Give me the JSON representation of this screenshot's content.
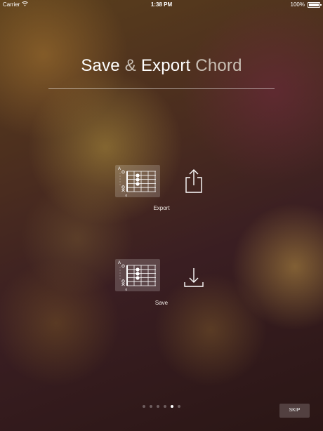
{
  "status_bar": {
    "carrier": "Carrier",
    "time": "1:38 PM",
    "battery_percent": "100%",
    "icons": [
      "wifi-icon",
      "battery-icon"
    ]
  },
  "title": {
    "word1": "Save",
    "amp": "&",
    "word2": "Export",
    "word3": "Chord"
  },
  "features": [
    {
      "label": "Export",
      "icon": "share-icon",
      "chord_card": "chord-diagram-icon"
    },
    {
      "label": "Save",
      "icon": "download-icon",
      "chord_card": "chord-diagram-icon"
    }
  ],
  "chord_diagram": {
    "chord_name": "A",
    "fret": "0"
  },
  "pagination": {
    "total": 6,
    "active_index": 4
  },
  "skip": {
    "label": "SKIP"
  },
  "colors": {
    "title_primary": "#ffffff",
    "title_secondary": "#c9bfb4",
    "background_dark": "#2a1615"
  }
}
